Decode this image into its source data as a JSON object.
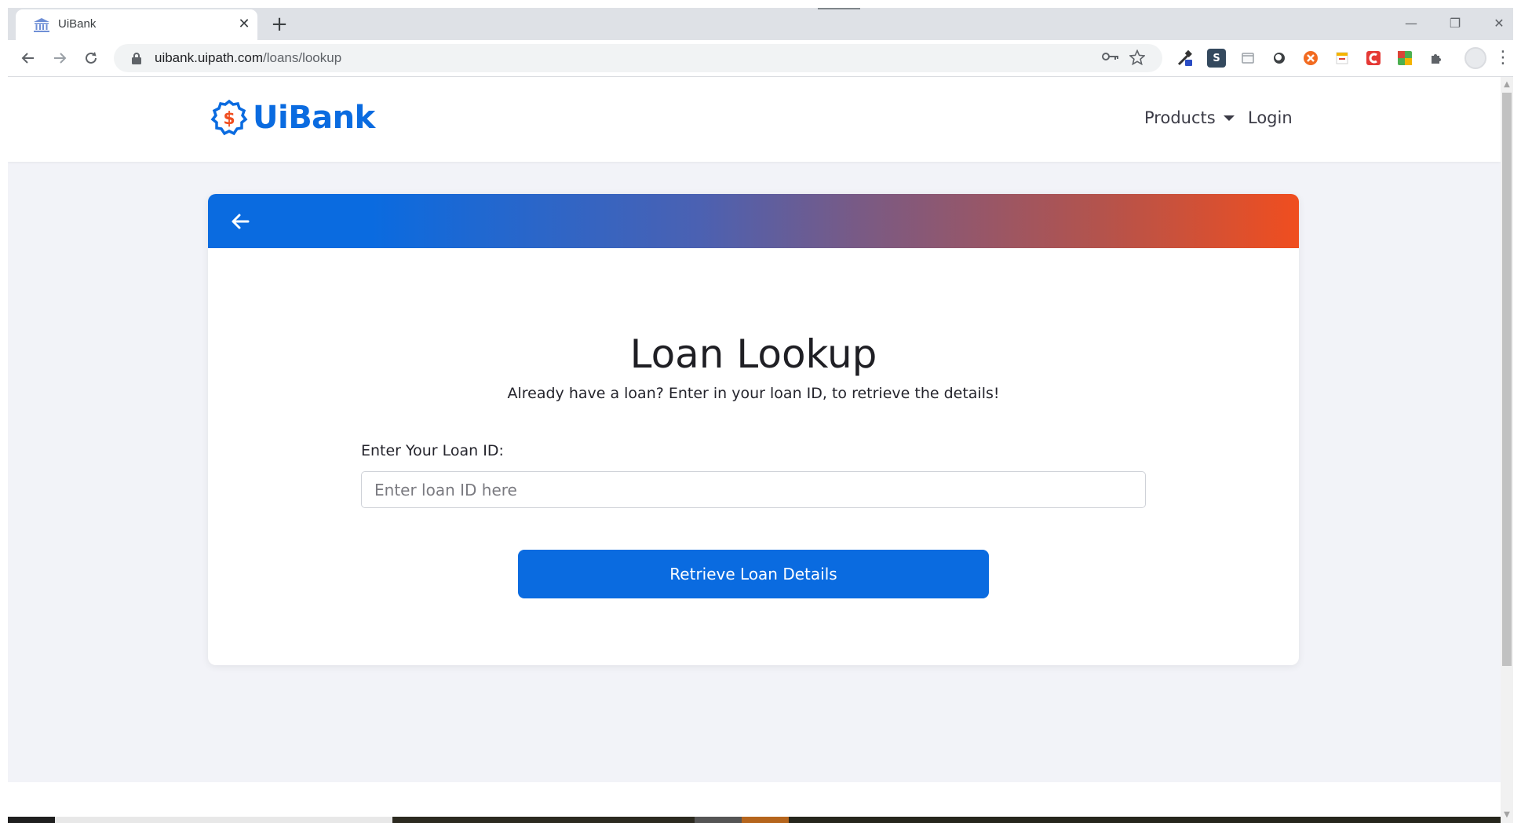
{
  "browser": {
    "tab_title": "UiBank",
    "tab_close": "✕",
    "new_tab": "+",
    "url_host": "uibank.uipath.com",
    "url_path": "/loans/lookup",
    "window_minimize": "—",
    "window_restore": "❐",
    "window_close": "✕",
    "menu": "⋮",
    "extensions": [
      {
        "name": "eyedropper-extension-icon"
      },
      {
        "name": "s-extension-icon",
        "label": "S"
      },
      {
        "name": "page-extension-icon"
      },
      {
        "name": "circle-extension-icon"
      },
      {
        "name": "orange-extension-icon"
      },
      {
        "name": "calendar-extension-icon"
      },
      {
        "name": "red-c-extension-icon"
      },
      {
        "name": "green-extension-icon"
      },
      {
        "name": "puzzle-extension-icon"
      }
    ]
  },
  "header": {
    "logo_text": "UiBank",
    "logo_symbol": "$",
    "nav_products": "Products",
    "nav_login": "Login"
  },
  "card": {
    "title": "Loan Lookup",
    "subtitle": "Already have a loan? Enter in your loan ID, to retrieve the details!",
    "field_label": "Enter Your Loan ID:",
    "input_placeholder": "Enter loan ID here",
    "input_value": "",
    "button_label": "Retrieve Loan Details"
  },
  "colors": {
    "brand_blue": "#0a6be0",
    "brand_orange": "#f04e1f",
    "page_background": "#f2f3f8"
  }
}
